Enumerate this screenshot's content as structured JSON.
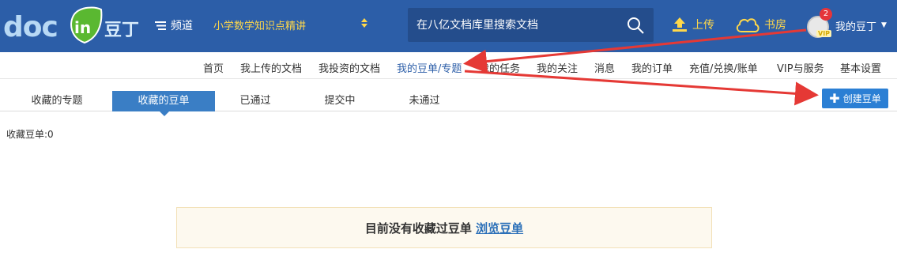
{
  "brand": {
    "logo_text": "doc",
    "logo_badge": "in",
    "logo_suffix": "豆丁"
  },
  "header": {
    "channel_label": "频道",
    "category_selected": "小学数学知识点精讲",
    "search_placeholder": "在八亿文档库里搜索文档",
    "upload_label": "上传",
    "bookshelf_label": "书房",
    "user_label": "我的豆丁",
    "notification_count": "2",
    "vip_label": "VIP"
  },
  "subnav": {
    "items": [
      {
        "label": "首页"
      },
      {
        "label": "我上传的文档"
      },
      {
        "label": "我投资的文档"
      },
      {
        "label": "我的豆单/专题"
      },
      {
        "label": "我的任务"
      },
      {
        "label": "我的关注"
      },
      {
        "label": "消息"
      },
      {
        "label": "我的订单"
      },
      {
        "label": "充值/兑换/账单"
      },
      {
        "label": "VIP与服务"
      },
      {
        "label": "基本设置"
      }
    ],
    "active_index": 3
  },
  "tabs": {
    "items": [
      {
        "label": "收藏的专题"
      },
      {
        "label": "收藏的豆单"
      },
      {
        "label": "已通过"
      },
      {
        "label": "提交中"
      },
      {
        "label": "未通过"
      }
    ],
    "active_index": 1,
    "create_label": "创建豆单"
  },
  "main": {
    "count_text": "收藏豆单:0",
    "empty_text": "目前没有收藏过豆单",
    "browse_link": "浏览豆单"
  },
  "colors": {
    "header_bg": "#2c5ea8",
    "accent_yellow": "#ffd84a",
    "tab_active": "#3a7ec5",
    "annotation_red": "#e53935"
  }
}
